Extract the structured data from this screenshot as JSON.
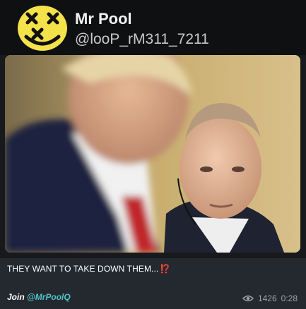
{
  "channel": {
    "name": "Mr Pool",
    "handle": "@looP_rM311_7211"
  },
  "post": {
    "caption": "THEY WANT TO TAKE DOWN THEM...",
    "caption_emoji": "⁉️",
    "join_prefix": "Join ",
    "join_link": "@MrPoolQ",
    "views": "1426",
    "time": "0:28"
  },
  "icons": {
    "avatar": "yellow-smiley-x-eyes-icon",
    "views": "eye-icon"
  },
  "colors": {
    "avatar_yellow": "#f3e24a",
    "link": "#4fc3c8",
    "emoji_red": "#e0342d"
  }
}
